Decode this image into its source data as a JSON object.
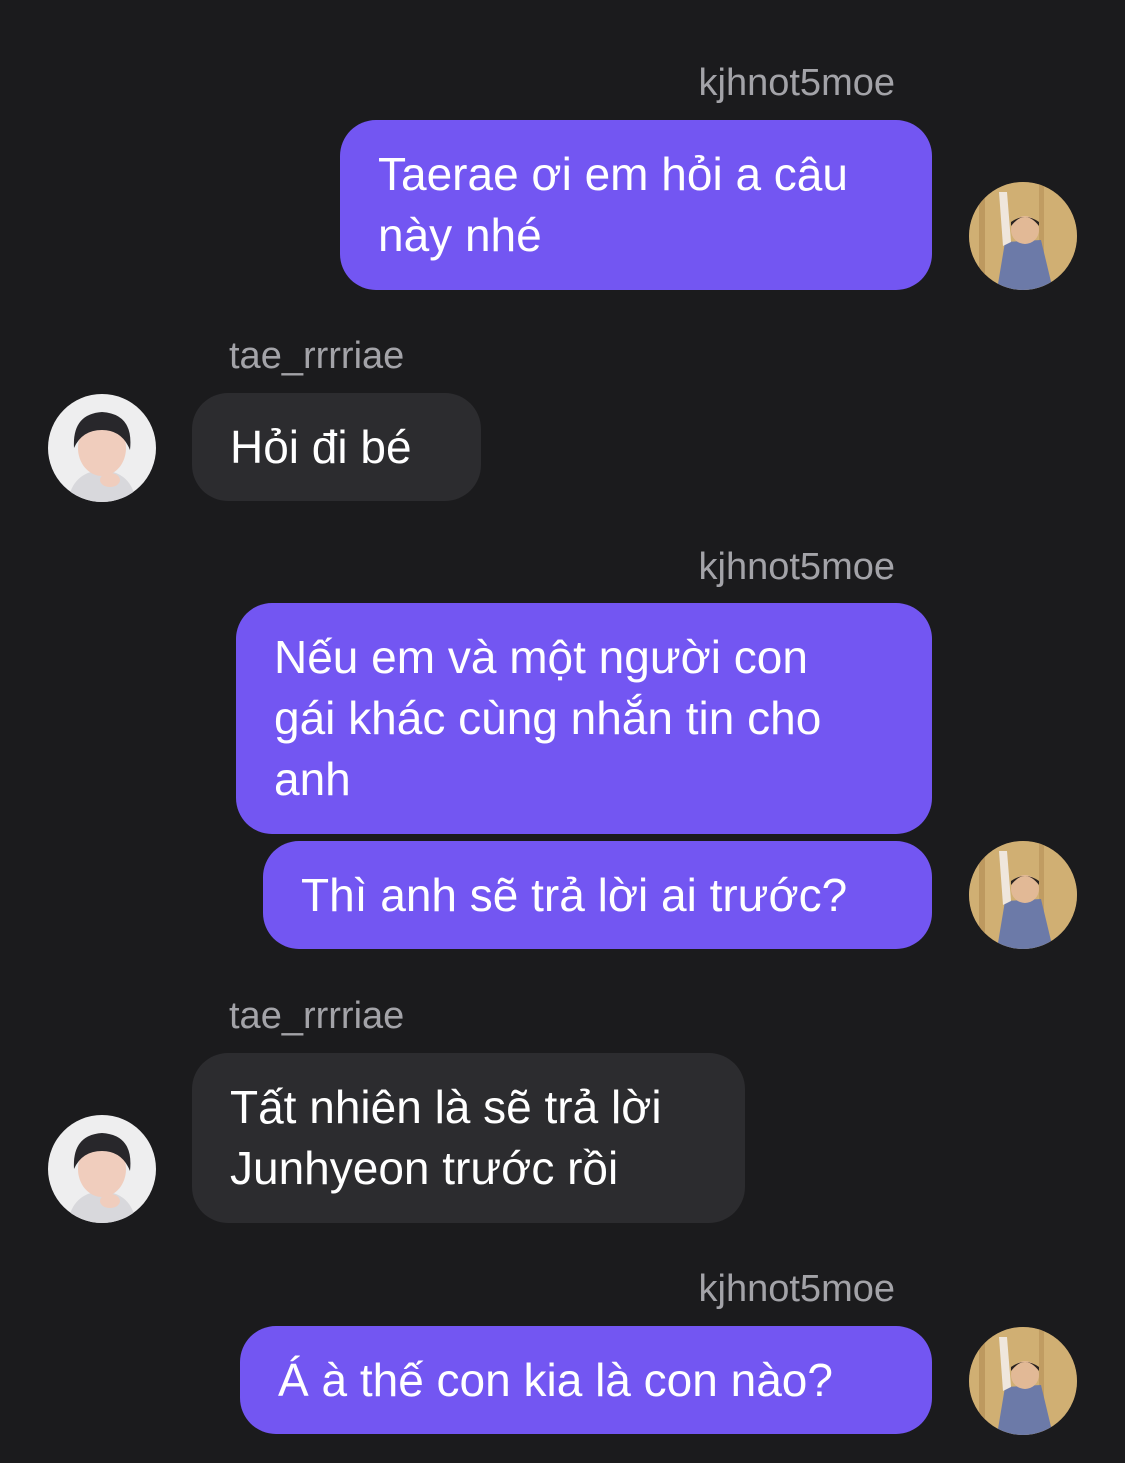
{
  "conversation": {
    "me": {
      "username": "kjhnot5moe"
    },
    "them": {
      "username": "tae_rrrriae"
    },
    "groups": [
      {
        "sender": "kjhnot5moe",
        "messages": [
          {
            "line1": "Taerae ơi em hỏi a câu",
            "line2": "này nhé"
          }
        ]
      },
      {
        "sender": "tae_rrrriae",
        "messages": [
          {
            "line1": "Hỏi đi bé"
          }
        ]
      },
      {
        "sender": "kjhnot5moe",
        "messages": [
          {
            "line1": "Nếu em và một người con",
            "line2": "gái khác cùng nhắn tin cho",
            "line3": "anh"
          },
          {
            "line1": "Thì anh sẽ trả lời ai trước?"
          }
        ]
      },
      {
        "sender": "tae_rrrriae",
        "messages": [
          {
            "line1": "Tất nhiên là sẽ trả lời",
            "line2": "Junhyeon trước rồi"
          }
        ]
      },
      {
        "sender": "kjhnot5moe",
        "messages": [
          {
            "line1": "Á à thế con kia là con nào?"
          }
        ]
      }
    ]
  },
  "colors": {
    "background": "#1b1b1d",
    "outgoing_bubble": "#7356f2",
    "incoming_bubble": "#2c2c2f",
    "username": "#a3a3a8",
    "message_text": "#ffffff"
  },
  "icons": {
    "me_avatar": "avatar-photo-icon",
    "them_avatar": "avatar-photo-icon"
  }
}
